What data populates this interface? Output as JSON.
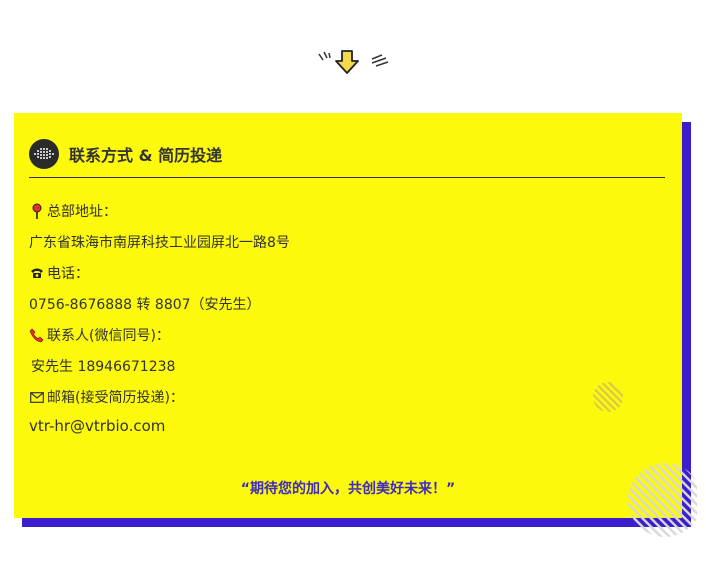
{
  "card": {
    "title": "联系方式 & 简历投递",
    "address_label": "总部地址：",
    "address_value": "广东省珠海市南屏科技工业园屏北一路8号",
    "phone_label": "电话：",
    "phone_value": "0756-8676888 转 8807（安先生）",
    "contact_label": "联系人(微信同号)：",
    "contact_value": "安先生  18946671238",
    "email_label": "邮箱(接受简历投递)：",
    "email_value": "vtr-hr@vtrbio.com",
    "slogan": "“期待您的加入，共创美好未来！”"
  },
  "colors": {
    "card_background": "#fcf90c",
    "card_shadow": "#3d1ecf",
    "slogan": "#3f2bbf",
    "arrow": "#f5d94c"
  },
  "icons": {
    "header": "logo-icon",
    "down": "down-arrow-icon",
    "address": "map-pin-icon",
    "phone": "telephone-icon",
    "contact": "phone-handset-icon",
    "email": "envelope-icon"
  }
}
